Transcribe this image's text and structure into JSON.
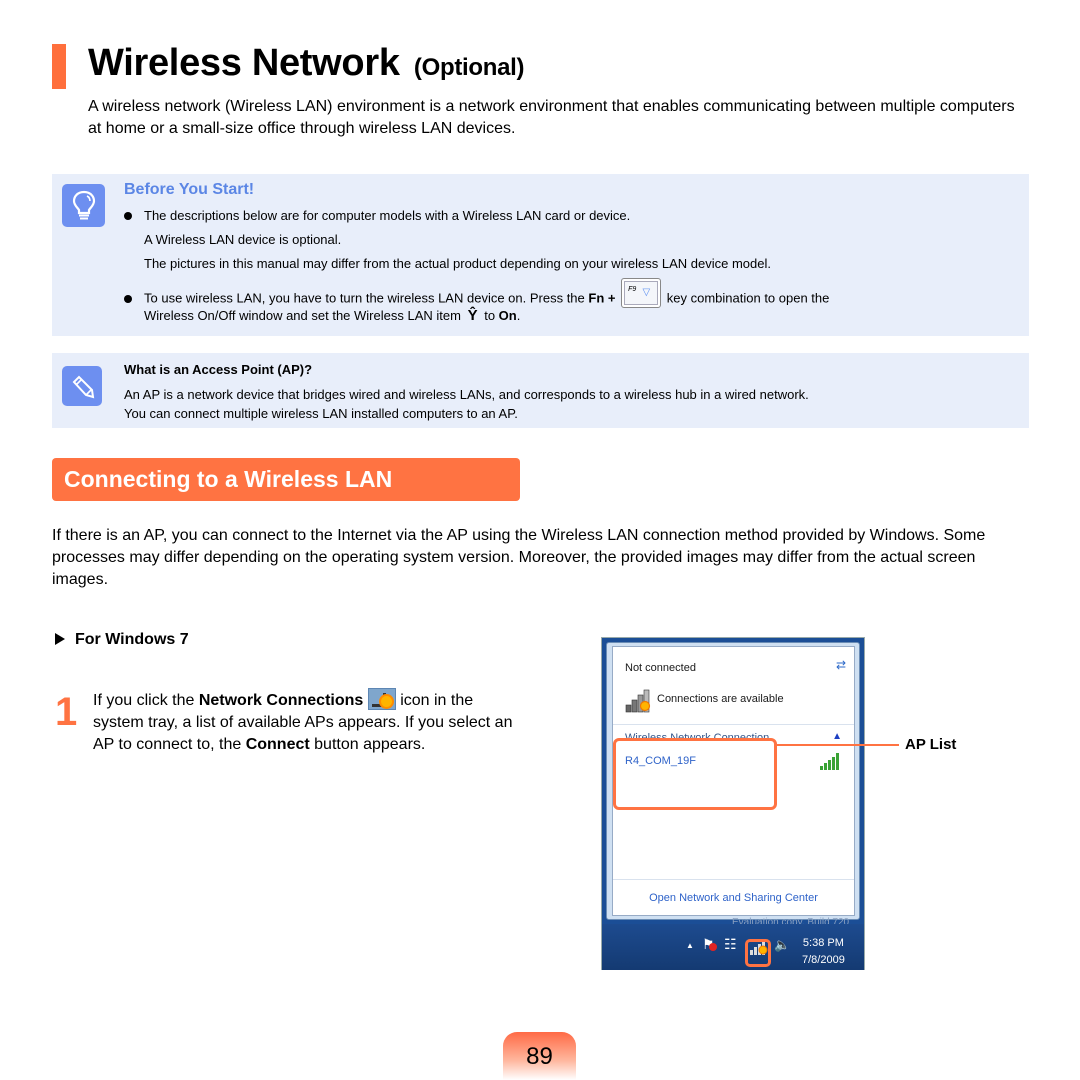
{
  "header": {
    "title": "Wireless Network",
    "title_suffix": "(Optional)",
    "intro": "A wireless network (Wireless LAN) environment is a network environment that enables communicating between multiple computers at home or a small-size office through wireless LAN devices."
  },
  "tip_box": {
    "icon": "lightbulb-icon",
    "heading": "Before You Start!",
    "bullet1_line1": "The descriptions below are for computer models with a Wireless LAN card or device.",
    "bullet1_line2": "A Wireless LAN device is optional.",
    "bullet1_line3": "The pictures in this manual may differ from the actual product depending on your wireless LAN device model.",
    "bullet2_pre": "To use wireless LAN, you have to turn the wireless LAN device on. Press the",
    "bullet2_fn": "Fn",
    "bullet2_plus": "+",
    "bullet2_key": "F9",
    "bullet2_post": "key combination to open the",
    "bullet2_line2_pre": "Wireless On/Off window and set the Wireless LAN item",
    "bullet2_line2_to": "to",
    "bullet2_line2_on": "On",
    "bullet2_line2_end": "."
  },
  "memo_box": {
    "icon": "pencil-icon",
    "heading": "What is an Access Point (AP)?",
    "line1": "An AP is a network device that bridges wired and wireless LANs, and corresponds to a wireless hub in a wired network.",
    "line2": "You can connect multiple wireless LAN installed computers to an AP."
  },
  "section": {
    "title": "Connecting to a Wireless LAN",
    "paragraph": "If there is an AP, you can connect to the Internet via the AP using the Wireless LAN connection method provided by Windows. Some processes may differ depending on the operating system version. Moreover, the provided images may differ from the actual screen images."
  },
  "os_heading": "For Windows 7",
  "step1": {
    "number": "1",
    "pre": "If you click the",
    "bold1": "Network Connections",
    "mid": "icon in the system tray, a list of available APs appears. If you select an AP to connect to, the",
    "bold2": "Connect",
    "post": "button appears."
  },
  "popup": {
    "status": "Not connected",
    "availability": "Connections are available",
    "group": "Wireless Network Connection",
    "ap_name": "R4_COM_19F",
    "footer_link": "Open Network and Sharing Center",
    "watermark": "Evaluation copy. Build 720",
    "clock_time": "5:38 PM",
    "clock_date": "7/8/2009"
  },
  "callout": {
    "label": "AP List"
  },
  "colors": {
    "accent": "#ff7342",
    "tip_heading": "#5b86e5",
    "note_bg": "#e8eefa"
  },
  "page_number": "89"
}
